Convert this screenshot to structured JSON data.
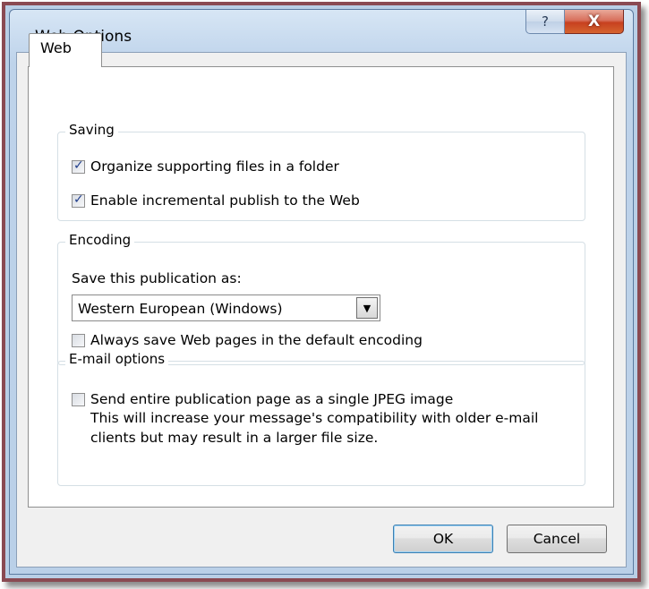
{
  "window": {
    "title": "Web Options",
    "help_glyph": "?",
    "close_glyph": "X"
  },
  "tabs": [
    {
      "label": "Web",
      "selected": true
    }
  ],
  "saving": {
    "label": "Saving",
    "organize": {
      "label": "Organize supporting files in a folder",
      "checked": true
    },
    "incremental": {
      "label": "Enable incremental publish to the Web",
      "checked": true
    }
  },
  "encoding": {
    "label": "Encoding",
    "save_as_label": "Save this publication as:",
    "selected_value": "Western European (Windows)",
    "always_default": {
      "label": "Always save Web pages in the default encoding",
      "checked": false
    }
  },
  "email": {
    "label": "E-mail options",
    "jpeg": {
      "label": "Send entire publication page as a single JPEG image",
      "checked": false
    },
    "description_line1": "This will increase your message's compatibility with older e-mail",
    "description_line2": "clients but may result in a larger file size."
  },
  "buttons": {
    "ok": "OK",
    "cancel": "Cancel"
  }
}
